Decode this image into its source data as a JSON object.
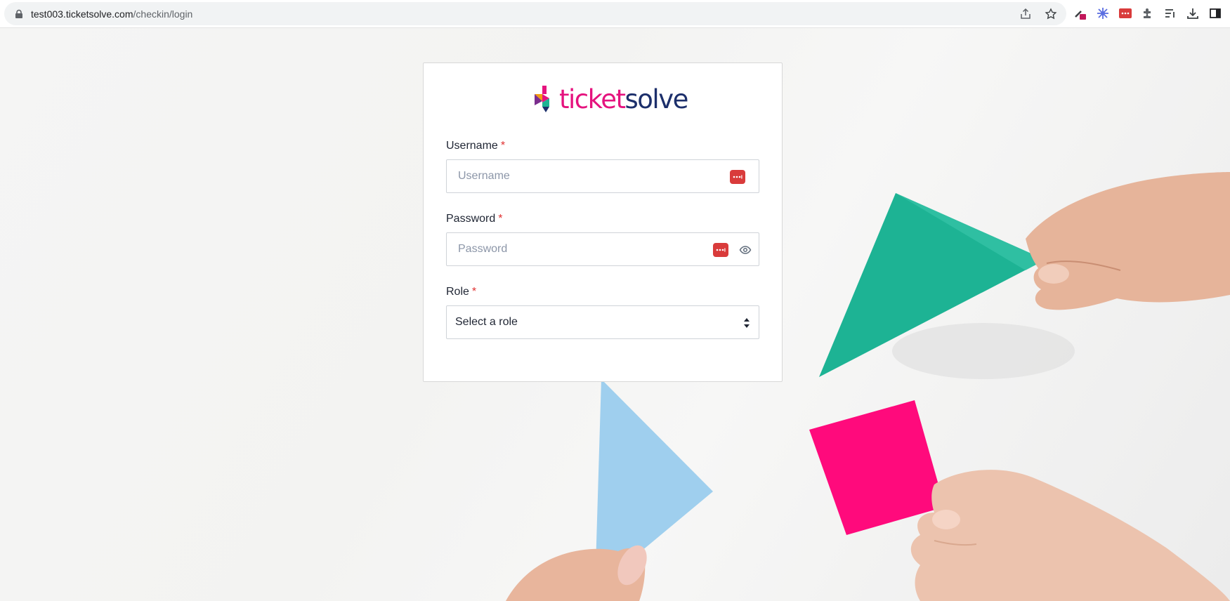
{
  "browser": {
    "url_host": "test003.ticketsolve.com",
    "url_path": "/checkin/login"
  },
  "logo": {
    "part1": "ticket",
    "part2": "solve"
  },
  "form": {
    "username": {
      "label": "Username",
      "required_mark": "*",
      "placeholder": "Username",
      "value": ""
    },
    "password": {
      "label": "Password",
      "required_mark": "*",
      "placeholder": "Password",
      "value": ""
    },
    "role": {
      "label": "Role",
      "required_mark": "*",
      "selected": "Select a role"
    }
  },
  "colors": {
    "brand_pink": "#e5137e",
    "brand_navy": "#1c2f6b",
    "required_red": "#e03131",
    "password_manager_red": "#d93b3b"
  }
}
